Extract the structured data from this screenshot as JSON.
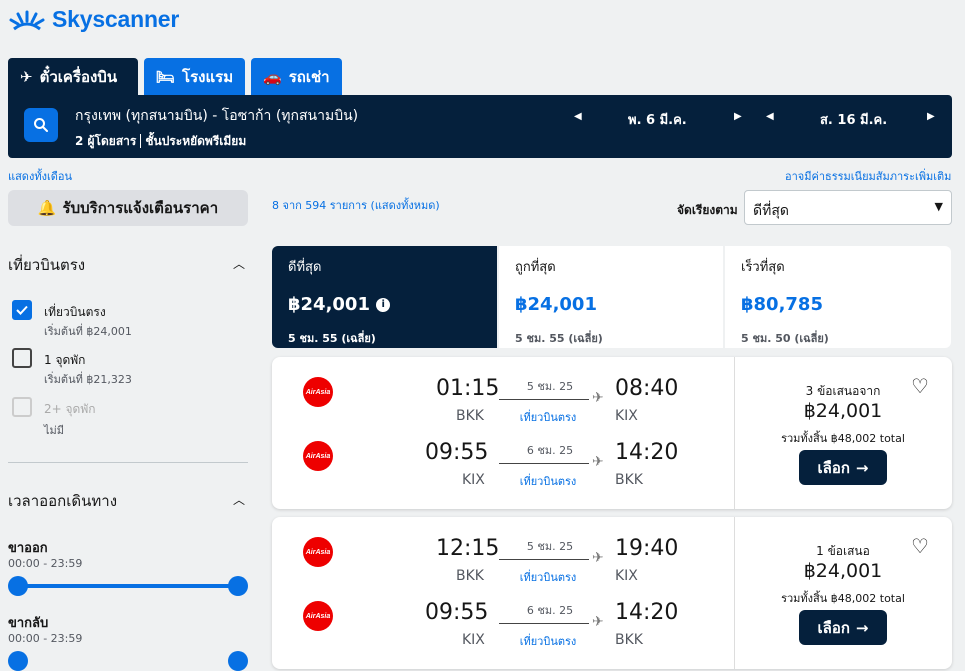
{
  "brand": {
    "name": "Skyscanner"
  },
  "tabs": [
    {
      "label": "ตั๋วเครื่องบิน",
      "icon": "plane-icon"
    },
    {
      "label": "โรงแรม",
      "icon": "bed-icon"
    },
    {
      "label": "รถเช่า",
      "icon": "car-icon"
    }
  ],
  "search": {
    "route": "กรุงเทพ (ทุกสนามบิน) - โอซาก้า (ทุกสนามบิน)",
    "passengers": "2 ผู้โดยสาร",
    "cabin": "ชั้นประหยัดพรีเมียม",
    "depart_date": "พ. 6 มี.ค.",
    "return_date": "ส. 16 มี.ค."
  },
  "links": {
    "show_all_months": "แสดงทั้งเดือน",
    "fees_note": "อาจมีค่าธรรมเนียมสัมภาระเพิ่มเติม",
    "results_count": "8 จาก 594 รายการ (แสดงทั้งหมด)"
  },
  "alert_button": "รับบริการแจ้งเตือนราคา",
  "sort": {
    "label": "จัดเรียงตาม",
    "value": "ดีที่สุด"
  },
  "filters": {
    "stops": {
      "title": "เที่ยวบินตรง",
      "options": [
        {
          "label": "เที่ยวบินตรง",
          "sub": "เริ่มต้นที่ ฿24,001",
          "checked": true
        },
        {
          "label": "1 จุดพัก",
          "sub": "เริ่มต้นที่ ฿21,323",
          "checked": false
        },
        {
          "label": "2+ จุดพัก",
          "sub": "ไม่มี",
          "checked": false
        }
      ]
    },
    "times": {
      "title": "เวลาออกเดินทาง",
      "outbound": {
        "label": "ขาออก",
        "range": "00:00 - 23:59"
      },
      "inbound": {
        "label": "ขากลับ",
        "range": "00:00 - 23:59"
      }
    }
  },
  "summary_cards": [
    {
      "title": "ดีที่สุด",
      "price": "฿24,001",
      "duration": "5 ชม. 55 (เฉลี่ย)"
    },
    {
      "title": "ถูกที่สุด",
      "price": "฿24,001",
      "duration": "5 ชม. 55 (เฉลี่ย)"
    },
    {
      "title": "เร็วที่สุด",
      "price": "฿80,785",
      "duration": "5 ชม. 50 (เฉลี่ย)"
    }
  ],
  "results": [
    {
      "legs": [
        {
          "airline": "AirAsia",
          "dep_time": "01:15",
          "dep_code": "BKK",
          "duration": "5 ชม. 25",
          "stops": "เที่ยวบินตรง",
          "arr_time": "08:40",
          "arr_code": "KIX"
        },
        {
          "airline": "AirAsia",
          "dep_time": "09:55",
          "dep_code": "KIX",
          "duration": "6 ชม. 25",
          "stops": "เที่ยวบินตรง",
          "arr_time": "14:20",
          "arr_code": "BKK"
        }
      ],
      "offers": "3 ข้อเสนอจาก",
      "price": "฿24,001",
      "total": "รวมทั้งสิ้น ฿48,002 total",
      "select": "เลือก"
    },
    {
      "legs": [
        {
          "airline": "AirAsia",
          "dep_time": "12:15",
          "dep_code": "BKK",
          "duration": "5 ชม. 25",
          "stops": "เที่ยวบินตรง",
          "arr_time": "19:40",
          "arr_code": "KIX"
        },
        {
          "airline": "AirAsia",
          "dep_time": "09:55",
          "dep_code": "KIX",
          "duration": "6 ชม. 25",
          "stops": "เที่ยวบินตรง",
          "arr_time": "14:20",
          "arr_code": "BKK"
        }
      ],
      "offers": "1 ข้อเสนอ",
      "price": "฿24,001",
      "total": "รวมทั้งสิ้น ฿48,002 total",
      "select": "เลือก"
    }
  ],
  "colors": {
    "brand": "#0770e3",
    "navy": "#05203c",
    "airline": "#ee0000"
  }
}
